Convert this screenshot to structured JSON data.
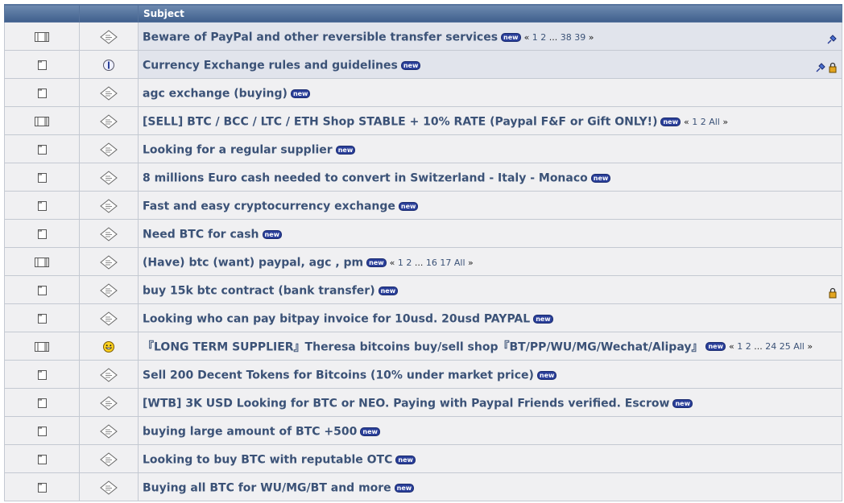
{
  "header": {
    "subject_label": "Subject"
  },
  "topics": [
    {
      "title": "Beware of PayPal and other reversible transfer services",
      "new": "new",
      "pages": [
        "«",
        "1",
        "2",
        "...",
        "38",
        "39",
        "»"
      ],
      "sticky": true,
      "locked": false,
      "multipage": true,
      "msg_icon": "standard"
    },
    {
      "title": "Currency Exchange rules and guidelines",
      "new": "new",
      "pages": [],
      "sticky": true,
      "locked": true,
      "multipage": false,
      "msg_icon": "info"
    },
    {
      "title": "agc exchange (buying)",
      "new": "new",
      "pages": [],
      "sticky": false,
      "locked": false,
      "multipage": false,
      "msg_icon": "standard"
    },
    {
      "title": "[SELL] BTC / BCC / LTC / ETH Shop STABLE + 10% RATE (Paypal F&F or Gift ONLY!)",
      "new": "new",
      "pages": [
        "«",
        "1",
        "2",
        "All",
        "»"
      ],
      "sticky": false,
      "locked": false,
      "multipage": true,
      "msg_icon": "standard"
    },
    {
      "title": "Looking for a regular supplier",
      "new": "new",
      "pages": [],
      "sticky": false,
      "locked": false,
      "multipage": false,
      "msg_icon": "standard"
    },
    {
      "title": "8 millions Euro cash needed to convert in Switzerland - Italy - Monaco",
      "new": "new",
      "pages": [],
      "sticky": false,
      "locked": false,
      "multipage": false,
      "msg_icon": "standard"
    },
    {
      "title": "Fast and easy cryptocurrency exchange",
      "new": "new",
      "pages": [],
      "sticky": false,
      "locked": false,
      "multipage": false,
      "msg_icon": "standard"
    },
    {
      "title": "Need BTC for cash",
      "new": "new",
      "pages": [],
      "sticky": false,
      "locked": false,
      "multipage": false,
      "msg_icon": "standard"
    },
    {
      "title": "(Have) btc (want) paypal, agc , pm",
      "new": "new",
      "pages": [
        "«",
        "1",
        "2",
        "...",
        "16",
        "17",
        "All",
        "»"
      ],
      "sticky": false,
      "locked": false,
      "multipage": true,
      "msg_icon": "standard"
    },
    {
      "title": "buy 15k btc contract (bank transfer)",
      "new": "new",
      "pages": [],
      "sticky": false,
      "locked": true,
      "multipage": false,
      "msg_icon": "standard"
    },
    {
      "title": "Looking who can pay bitpay invoice for 10usd. 20usd PAYPAL",
      "new": "new",
      "pages": [],
      "sticky": false,
      "locked": false,
      "multipage": false,
      "msg_icon": "standard"
    },
    {
      "title": "『LONG TERM SUPPLIER』Theresa bitcoins buy/sell shop『BT/PP/WU/MG/Wechat/Alipay』",
      "new": "new",
      "pages": [
        "«",
        "1",
        "2",
        "...",
        "24",
        "25",
        "All",
        "»"
      ],
      "sticky": false,
      "locked": false,
      "multipage": true,
      "msg_icon": "grin"
    },
    {
      "title": "Sell 200 Decent Tokens for Bitcoins (10% under market price)",
      "new": "new",
      "pages": [],
      "sticky": false,
      "locked": false,
      "multipage": false,
      "msg_icon": "standard"
    },
    {
      "title": "[WTB] 3K USD Looking for BTC or NEO. Paying with Paypal Friends verified. Escrow",
      "new": "new",
      "pages": [],
      "sticky": false,
      "locked": false,
      "multipage": false,
      "msg_icon": "standard"
    },
    {
      "title": "buying large amount of BTC +500",
      "new": "new",
      "pages": [],
      "sticky": false,
      "locked": false,
      "multipage": false,
      "msg_icon": "standard"
    },
    {
      "title": "Looking to buy BTC with reputable OTC",
      "new": "new",
      "pages": [],
      "sticky": false,
      "locked": false,
      "multipage": false,
      "msg_icon": "standard"
    },
    {
      "title": "Buying all BTC for WU/MG/BT and more",
      "new": "new",
      "pages": [],
      "sticky": false,
      "locked": false,
      "multipage": false,
      "msg_icon": "standard"
    }
  ],
  "colors": {
    "header_bg": "#4a6a96",
    "row_bg": "#f0f0f2",
    "sticky_bg": "#e1e4ec",
    "title_color": "#3b5277",
    "new_badge": "#2a3f99"
  }
}
